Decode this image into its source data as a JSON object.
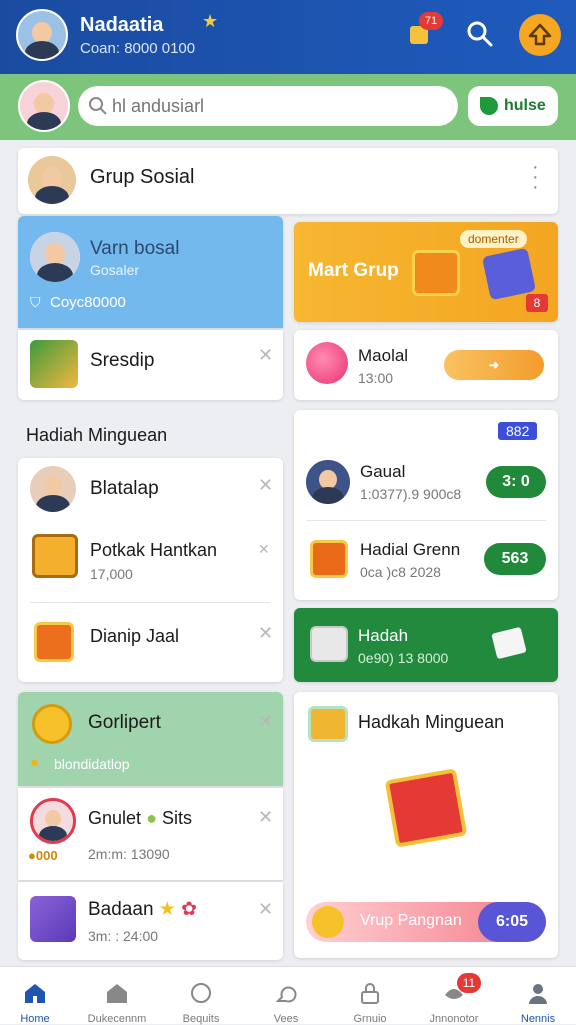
{
  "header": {
    "name": "Nadaatia",
    "subtitle": "Coan: 8000 0100",
    "badge_count": "71",
    "colors": {
      "bar": "#1f54b0",
      "accent": "#f5a623"
    }
  },
  "search": {
    "placeholder": "hl andusiarl",
    "button_label": "hulse"
  },
  "group": {
    "title": "Grup Sosial"
  },
  "left_top": {
    "title": "Varn bosal",
    "subtitle": "Gosaler",
    "amount": "Coyc80000"
  },
  "left_item1": {
    "label": "Sresdip"
  },
  "promo": {
    "label": "Mart Grup",
    "tag": "domenter",
    "mini": "8"
  },
  "right_item1": {
    "title": "Maolal",
    "value": "13:00"
  },
  "section_title": "Hadiah Minguean",
  "left_list": [
    {
      "title": "Blatalap"
    },
    {
      "title": "Potkak Hantkan",
      "subtitle": "17,000"
    },
    {
      "title": "Dianip Jaal"
    }
  ],
  "right_list_badge": "882",
  "right_list": [
    {
      "title": "Gaual",
      "subtitle": "1:0377).9 900c8",
      "button": "3: 0"
    },
    {
      "title": "Hadial Grenn",
      "subtitle": "0ca )c8 2028",
      "button": "563"
    }
  ],
  "green_card": {
    "title": "Hadah",
    "subtitle": "0e90) 13 8000"
  },
  "left_bottom": [
    {
      "title": "Gorlipert",
      "sub": "blondidatlop"
    },
    {
      "title": "Gnulet",
      "extra": "Sits",
      "meta": "2m:m: 13090",
      "coin": "000"
    },
    {
      "title": "Badaan",
      "meta": "3m: : 24:00"
    }
  ],
  "right_bottom": {
    "title": "Hadkah Minguean",
    "banner_label": "Vrup Pangnan",
    "banner_value": "6:05"
  },
  "nav": {
    "items": [
      {
        "label": "Home",
        "icon": "home-icon"
      },
      {
        "label": "Dukecennm",
        "icon": "house-icon"
      },
      {
        "label": "Bequits",
        "icon": "chat-icon"
      },
      {
        "label": "Vees",
        "icon": "heart-icon"
      },
      {
        "label": "Grnuio",
        "icon": "lock-icon"
      },
      {
        "label": "Jnnonotor",
        "icon": "game-icon"
      },
      {
        "label": "Nennis",
        "icon": "person-icon"
      }
    ],
    "badge": "11",
    "active_color": "#1f54b0"
  }
}
